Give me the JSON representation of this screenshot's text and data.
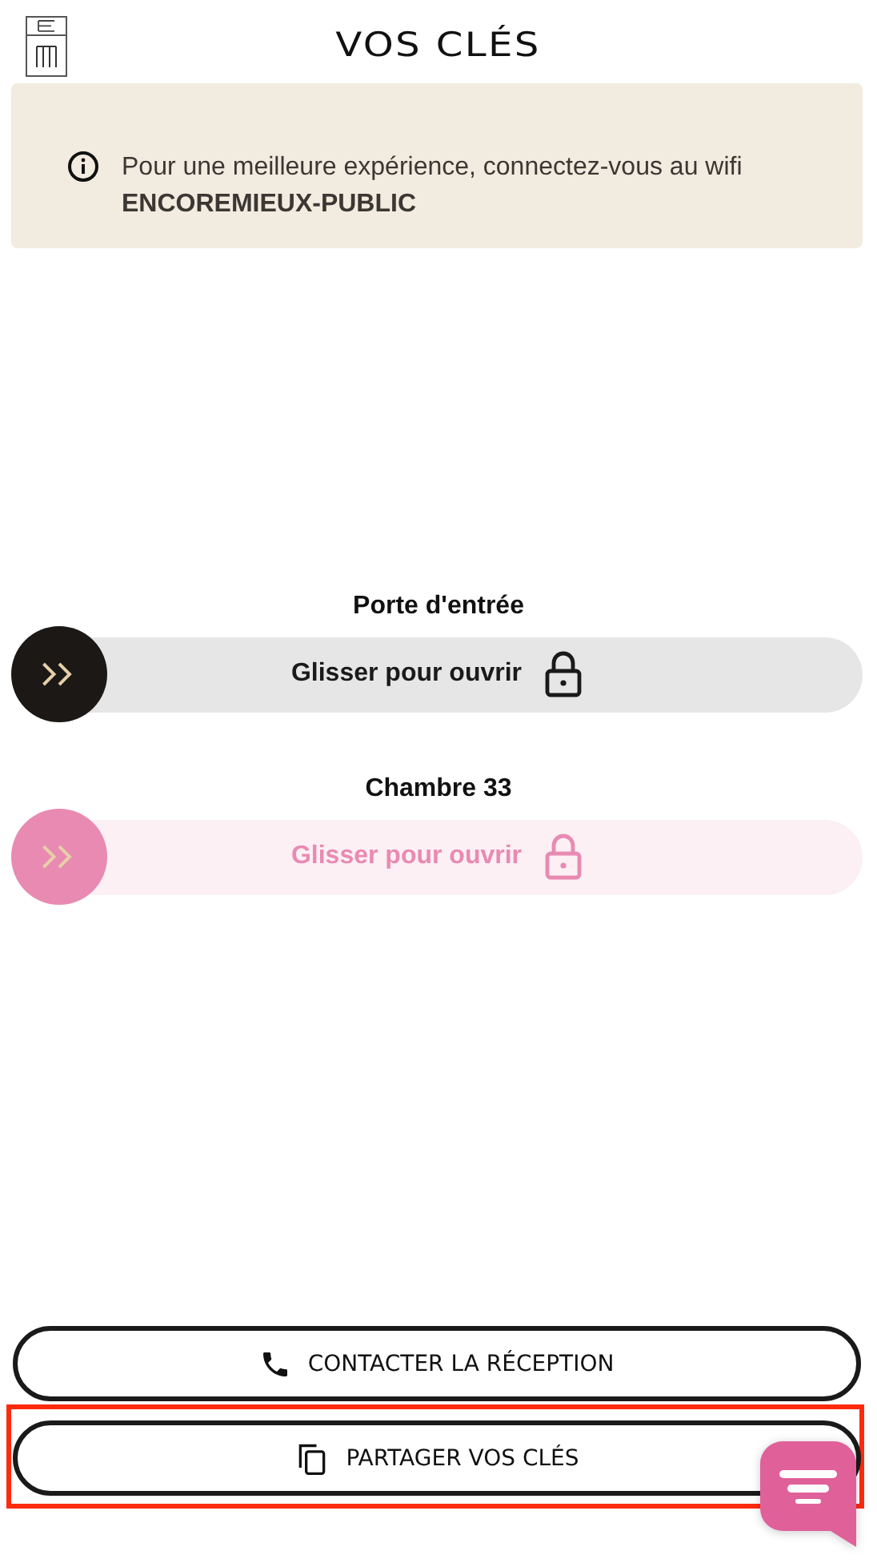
{
  "header": {
    "title": "VOS CLÉS"
  },
  "notice": {
    "text": "Pour une meilleure expérience, connectez-vous au wifi",
    "network": "ENCOREMIEUX-PUBLIC"
  },
  "keys": [
    {
      "name": "Porte d'entrée",
      "action": "Glisser pour ouvrir",
      "disabled": false
    },
    {
      "name": "Chambre 33",
      "action": "Glisser pour ouvrir",
      "disabled": true
    }
  ],
  "buttons": [
    {
      "kind": "phone",
      "label": "CONTACTER LA RÉCEPTION",
      "highlighted": false
    },
    {
      "kind": "copy",
      "label": "PARTAGER VOS CLÉS",
      "highlighted": true
    }
  ]
}
